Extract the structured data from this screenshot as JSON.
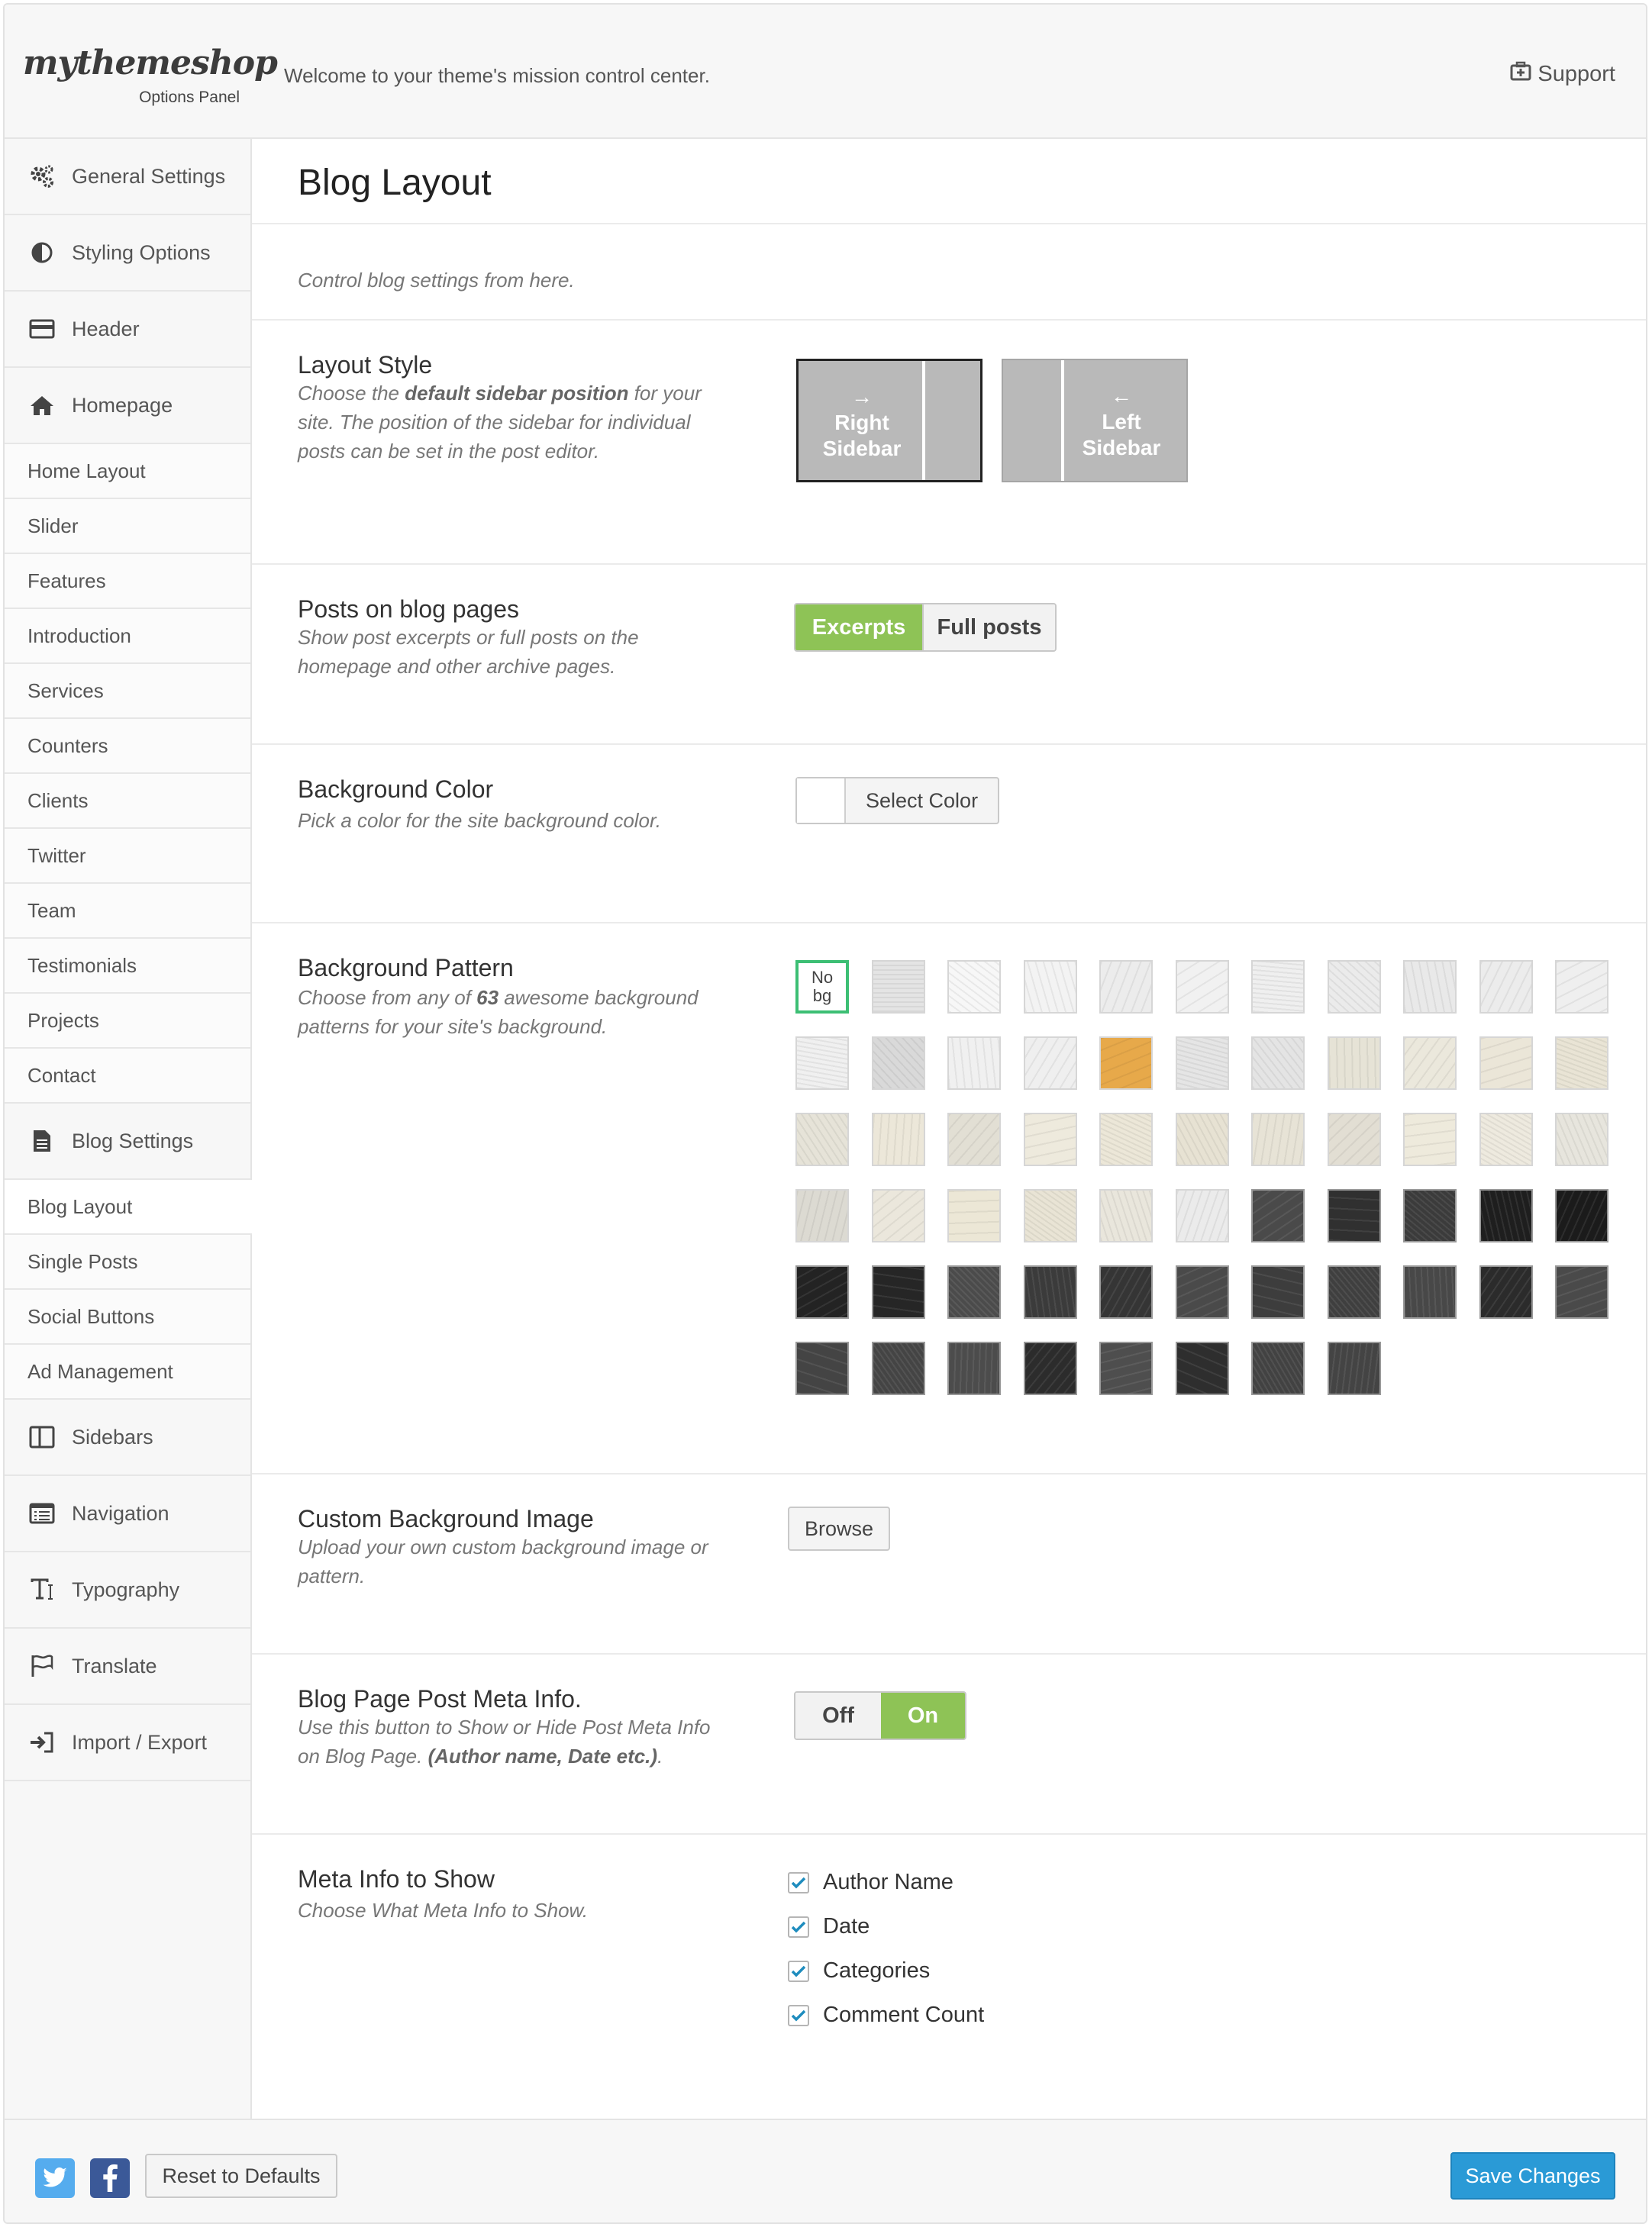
{
  "header": {
    "logo": "mythemeshop",
    "logo_sub": "Options Panel",
    "welcome": "Welcome to your theme's mission control center.",
    "support_label": "Support"
  },
  "sidebar": {
    "items": [
      {
        "label": "General Settings",
        "type": "main",
        "icon": "gears-icon"
      },
      {
        "label": "Styling Options",
        "type": "main",
        "icon": "contrast-icon"
      },
      {
        "label": "Header",
        "type": "main",
        "icon": "header-card-icon"
      },
      {
        "label": "Homepage",
        "type": "main",
        "icon": "home-icon"
      },
      {
        "label": "Home Layout",
        "type": "sub"
      },
      {
        "label": "Slider",
        "type": "sub"
      },
      {
        "label": "Features",
        "type": "sub"
      },
      {
        "label": "Introduction",
        "type": "sub"
      },
      {
        "label": "Services",
        "type": "sub"
      },
      {
        "label": "Counters",
        "type": "sub"
      },
      {
        "label": "Clients",
        "type": "sub"
      },
      {
        "label": "Twitter",
        "type": "sub"
      },
      {
        "label": "Team",
        "type": "sub"
      },
      {
        "label": "Testimonials",
        "type": "sub"
      },
      {
        "label": "Projects",
        "type": "sub"
      },
      {
        "label": "Contact",
        "type": "sub"
      },
      {
        "label": "Blog Settings",
        "type": "main",
        "icon": "document-icon"
      },
      {
        "label": "Blog Layout",
        "type": "sub",
        "active": true
      },
      {
        "label": "Single Posts",
        "type": "sub"
      },
      {
        "label": "Social Buttons",
        "type": "sub"
      },
      {
        "label": "Ad Management",
        "type": "sub"
      },
      {
        "label": "Sidebars",
        "type": "main",
        "icon": "columns-icon"
      },
      {
        "label": "Navigation",
        "type": "main",
        "icon": "list-window-icon"
      },
      {
        "label": "Typography",
        "type": "main",
        "icon": "typography-icon"
      },
      {
        "label": "Translate",
        "type": "main",
        "icon": "flag-icon"
      },
      {
        "label": "Import / Export",
        "type": "main",
        "icon": "sign-in-icon"
      }
    ]
  },
  "page": {
    "title": "Blog Layout",
    "description": "Control blog settings from here."
  },
  "layout_style": {
    "title": "Layout Style",
    "desc_pre": "Choose the ",
    "desc_bold": "default sidebar position",
    "desc_post": " for your site. The position of the sidebar for individual posts can be set in the post editor.",
    "options": [
      {
        "arrow": "→",
        "label1": "Right",
        "label2": "Sidebar",
        "selected": true
      },
      {
        "arrow": "←",
        "label1": "Left",
        "label2": "Sidebar",
        "selected": false
      }
    ]
  },
  "posts_on_blog": {
    "title": "Posts on blog pages",
    "desc": "Show post excerpts or full posts on the homepage and other archive pages.",
    "options": [
      "Excerpts",
      "Full posts"
    ],
    "selected": "Excerpts"
  },
  "background_color": {
    "title": "Background Color",
    "desc": "Pick a color for the site background color.",
    "button_label": "Select Color"
  },
  "background_pattern": {
    "title": "Background Pattern",
    "desc_pre": "Choose from any of ",
    "desc_bold": "63",
    "desc_post": " awesome background patterns for your site's background.",
    "no_bg_label_1": "No",
    "no_bg_label_2": "bg",
    "selected": "nobg",
    "patterns": [
      "#e4e4e4",
      "#f7f7f7",
      "#f3f3f3",
      "#ececec",
      "#f1f1f1",
      "#efefef",
      "#ebebeb",
      "#e9e9e9",
      "#ececec",
      "#efefef",
      "#f0f0f0",
      "#d9d9d9",
      "#f0f0f0",
      "#efefef",
      "#e7a94a",
      "#e5e5e5",
      "#e4e4e4",
      "#e6e3d6",
      "#ebe8dc",
      "#ebe6d8",
      "#e9e4d5",
      "#e6e3d8",
      "#ece7d9",
      "#e2dfd4",
      "#eeeadd",
      "#ece7d8",
      "#e7e2d3",
      "#e7e3d6",
      "#e2ded3",
      "#eeeadc",
      "#eeeadf",
      "#e7e5dd",
      "#dcdad2",
      "#ebe7dc",
      "#ece7d6",
      "#e9e4d5",
      "#e9e6dc",
      "#ebebeb",
      "#4a4a4a",
      "#303030",
      "#3b3b3b",
      "#1e1e1e",
      "#1b1b1b",
      "#232323",
      "#262626",
      "#4b4b4b",
      "#3b3b3b",
      "#353535",
      "#4a4a4a",
      "#3d3d3d",
      "#3f3f3f",
      "#484848",
      "#2b2b2b",
      "#4a4a4a",
      "#444444",
      "#444444",
      "#4c4c4c",
      "#2c2c2c",
      "#4e4e4e",
      "#2e2e2e",
      "#424242",
      "#444444"
    ]
  },
  "custom_bg": {
    "title": "Custom Background Image",
    "desc": "Upload your own custom background image or pattern.",
    "button_label": "Browse"
  },
  "meta_info": {
    "title": "Blog Page Post Meta Info.",
    "desc_pre": "Use this button to Show or Hide Post Meta Info on Blog Page. ",
    "desc_bold": "(Author name, Date etc.)",
    "desc_post": ".",
    "options": [
      "Off",
      "On"
    ],
    "selected": "On"
  },
  "meta_show": {
    "title": "Meta Info to Show",
    "desc": "Choose What Meta Info to Show.",
    "items": [
      {
        "label": "Author Name",
        "checked": true
      },
      {
        "label": "Date",
        "checked": true
      },
      {
        "label": "Categories",
        "checked": true
      },
      {
        "label": "Comment Count",
        "checked": true
      }
    ]
  },
  "footer": {
    "reset_label": "Reset to Defaults",
    "save_label": "Save Changes"
  },
  "colors": {
    "accent_green": "#8ec356",
    "save_blue": "#2a9ad6",
    "twitter": "#55acee",
    "facebook": "#3b5998"
  }
}
